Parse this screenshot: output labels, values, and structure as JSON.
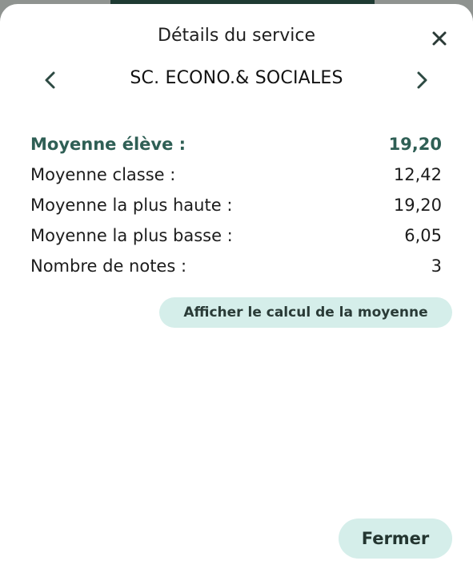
{
  "dialog": {
    "title": "Détails du service",
    "subject": "SC. ECONO.& SOCIALES",
    "calc_button_label": "Afficher le calcul de la moyenne",
    "close_button_label": "Fermer"
  },
  "stats": [
    {
      "label": "Moyenne élève :",
      "value": "19,20",
      "highlight": true
    },
    {
      "label": "Moyenne classe :",
      "value": "12,42",
      "highlight": false
    },
    {
      "label": "Moyenne la plus haute :",
      "value": "19,20",
      "highlight": false
    },
    {
      "label": "Moyenne la plus basse :",
      "value": "6,05",
      "highlight": false
    },
    {
      "label": "Nombre de notes :",
      "value": "3",
      "highlight": false
    }
  ],
  "icons": {
    "close": "close-icon",
    "prev": "chevron-left-icon",
    "next": "chevron-right-icon"
  },
  "colors": {
    "accent": "#2f5f55",
    "button_bg": "#d5eeea"
  }
}
